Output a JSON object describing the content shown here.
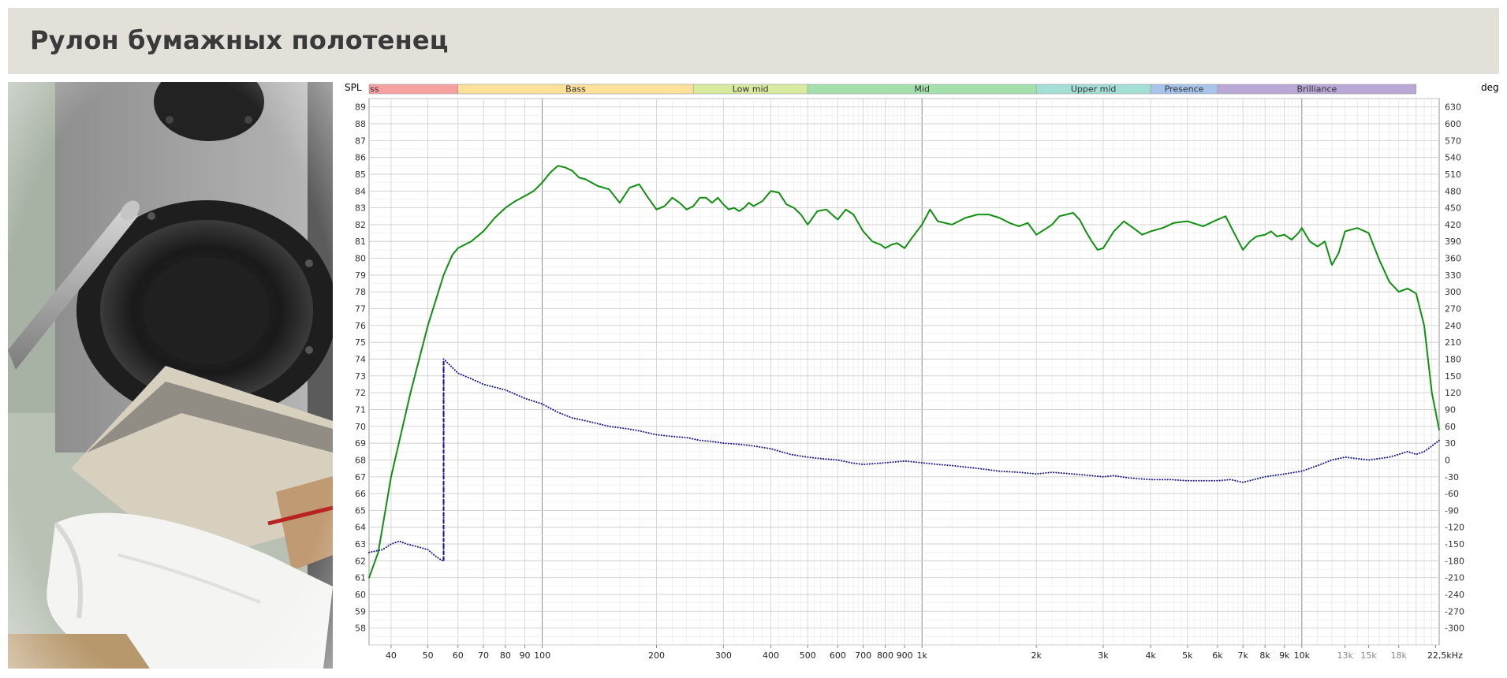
{
  "header": {
    "title": "Рулон бумажных полотенец"
  },
  "photo": {
    "subject": "speaker-woofer-with-measurement-microphone-and-paper-towel-roll"
  },
  "chart_data": {
    "type": "line",
    "title": "",
    "xscale": "log",
    "xlim": [
      35,
      23000
    ],
    "x_ticks": [
      {
        "v": 40,
        "label": "40"
      },
      {
        "v": 50,
        "label": "50"
      },
      {
        "v": 60,
        "label": "60"
      },
      {
        "v": 70,
        "label": "70"
      },
      {
        "v": 80,
        "label": "80"
      },
      {
        "v": 90,
        "label": "90"
      },
      {
        "v": 100,
        "label": "100"
      },
      {
        "v": 200,
        "label": "200"
      },
      {
        "v": 300,
        "label": "300"
      },
      {
        "v": 400,
        "label": "400"
      },
      {
        "v": 500,
        "label": "500"
      },
      {
        "v": 600,
        "label": "600"
      },
      {
        "v": 700,
        "label": "700"
      },
      {
        "v": 800,
        "label": "800"
      },
      {
        "v": 900,
        "label": "900"
      },
      {
        "v": 1000,
        "label": "1k"
      },
      {
        "v": 2000,
        "label": "2k"
      },
      {
        "v": 3000,
        "label": "3k"
      },
      {
        "v": 4000,
        "label": "4k"
      },
      {
        "v": 5000,
        "label": "5k"
      },
      {
        "v": 6000,
        "label": "6k"
      },
      {
        "v": 7000,
        "label": "7k"
      },
      {
        "v": 8000,
        "label": "8k"
      },
      {
        "v": 9000,
        "label": "9k"
      },
      {
        "v": 10000,
        "label": "10k"
      },
      {
        "v": 13000,
        "label": "13k"
      },
      {
        "v": 15000,
        "label": "15k"
      },
      {
        "v": 18000,
        "label": "18k"
      },
      {
        "v": 22500,
        "label": "22,5kHz"
      }
    ],
    "y_left": {
      "label": "SPL",
      "lim": [
        57,
        89.5
      ],
      "ticks": [
        58,
        59,
        60,
        61,
        62,
        63,
        64,
        65,
        66,
        67,
        68,
        69,
        70,
        71,
        72,
        73,
        74,
        75,
        76,
        77,
        78,
        79,
        80,
        81,
        82,
        83,
        84,
        85,
        86,
        87,
        88,
        89
      ]
    },
    "y_right": {
      "label": "deg",
      "lim": [
        -330,
        645
      ],
      "ticks": [
        -300,
        -270,
        -240,
        -210,
        -180,
        -150,
        -120,
        -90,
        -60,
        -30,
        0,
        30,
        60,
        90,
        120,
        150,
        180,
        210,
        240,
        270,
        300,
        330,
        360,
        390,
        420,
        450,
        480,
        510,
        540,
        570,
        600,
        630
      ]
    },
    "grid": true,
    "bands": [
      {
        "label": "ss",
        "from": 35,
        "to": 60,
        "color": "#f7a0a0"
      },
      {
        "label": "Bass",
        "from": 60,
        "to": 250,
        "color": "#fde09a"
      },
      {
        "label": "Low mid",
        "from": 250,
        "to": 500,
        "color": "#d7eaa0"
      },
      {
        "label": "Mid",
        "from": 500,
        "to": 2000,
        "color": "#a3e0ad"
      },
      {
        "label": "Upper mid",
        "from": 2000,
        "to": 4000,
        "color": "#a4dfd6"
      },
      {
        "label": "Presence",
        "from": 4000,
        "to": 6000,
        "color": "#a8c4ea"
      },
      {
        "label": "Brilliance",
        "from": 6000,
        "to": 20000,
        "color": "#b9a8d6"
      }
    ],
    "series": [
      {
        "axis": "left",
        "color": "#109010",
        "style": "solid",
        "x": [
          35,
          37,
          40,
          45,
          50,
          55,
          58,
          60,
          65,
          70,
          75,
          80,
          85,
          90,
          95,
          100,
          105,
          110,
          115,
          120,
          125,
          130,
          140,
          150,
          160,
          170,
          180,
          190,
          200,
          210,
          220,
          230,
          240,
          250,
          260,
          270,
          280,
          290,
          300,
          310,
          320,
          330,
          340,
          350,
          360,
          380,
          400,
          420,
          440,
          460,
          480,
          500,
          530,
          560,
          600,
          630,
          660,
          700,
          740,
          780,
          800,
          830,
          860,
          900,
          940,
          1000,
          1050,
          1100,
          1200,
          1300,
          1400,
          1500,
          1600,
          1700,
          1800,
          1900,
          2000,
          2100,
          2200,
          2300,
          2400,
          2500,
          2600,
          2700,
          2800,
          2900,
          3000,
          3200,
          3400,
          3600,
          3800,
          4000,
          4300,
          4600,
          5000,
          5500,
          6000,
          6300,
          6600,
          7000,
          7300,
          7600,
          8000,
          8300,
          8600,
          9000,
          9400,
          9800,
          10000,
          10500,
          11000,
          11500,
          12000,
          12500,
          13000,
          14000,
          15000,
          16000,
          17000,
          18000,
          19000,
          20000,
          21000,
          22000,
          23000
        ],
        "values": [
          61.0,
          62.5,
          67.0,
          72.0,
          76.0,
          79.0,
          80.2,
          80.6,
          81.0,
          81.6,
          82.4,
          83.0,
          83.4,
          83.7,
          84.0,
          84.5,
          85.1,
          85.5,
          85.4,
          85.2,
          84.8,
          84.7,
          84.3,
          84.1,
          83.3,
          84.2,
          84.4,
          83.6,
          82.9,
          83.1,
          83.6,
          83.3,
          82.9,
          83.1,
          83.6,
          83.6,
          83.3,
          83.6,
          83.2,
          82.9,
          83.0,
          82.8,
          83.0,
          83.3,
          83.1,
          83.4,
          84.0,
          83.9,
          83.2,
          83.0,
          82.6,
          82.0,
          82.8,
          82.9,
          82.3,
          82.9,
          82.6,
          81.6,
          81.0,
          80.8,
          80.6,
          80.8,
          80.9,
          80.6,
          81.2,
          82.0,
          82.9,
          82.2,
          82.0,
          82.4,
          82.6,
          82.6,
          82.4,
          82.1,
          81.9,
          82.1,
          81.4,
          81.7,
          82.0,
          82.5,
          82.6,
          82.7,
          82.3,
          81.6,
          81.0,
          80.5,
          80.6,
          81.6,
          82.2,
          81.8,
          81.4,
          81.6,
          81.8,
          82.1,
          82.2,
          81.9,
          82.3,
          82.5,
          81.6,
          80.5,
          81.0,
          81.3,
          81.4,
          81.6,
          81.3,
          81.4,
          81.1,
          81.5,
          81.8,
          81.0,
          80.7,
          81.0,
          79.6,
          80.3,
          81.6,
          81.8,
          81.5,
          79.9,
          78.6,
          78.0,
          78.2,
          77.9,
          76.0,
          72.0,
          69.8
        ]
      },
      {
        "axis": "right",
        "color": "#1010a0",
        "style": "dotted",
        "x": [
          35,
          38,
          40,
          42,
          44,
          47,
          50,
          52,
          54,
          55,
          55.01,
          56,
          58,
          60,
          65,
          70,
          80,
          90,
          100,
          110,
          120,
          130,
          150,
          170,
          180,
          200,
          220,
          240,
          260,
          280,
          300,
          330,
          360,
          400,
          450,
          500,
          550,
          600,
          650,
          700,
          800,
          900,
          1000,
          1100,
          1200,
          1400,
          1600,
          1800,
          2000,
          2200,
          2500,
          2800,
          3000,
          3200,
          3500,
          4000,
          4500,
          5000,
          5500,
          6000,
          6500,
          7000,
          8000,
          9000,
          10000,
          10500,
          11000,
          11500,
          12000,
          13000,
          15000,
          17000,
          18000,
          19000,
          20000,
          21000,
          22000,
          23000
        ],
        "values": [
          -165,
          -160,
          -150,
          -145,
          -150,
          -155,
          -160,
          -170,
          -178,
          -180,
          180,
          175,
          165,
          155,
          145,
          135,
          125,
          110,
          100,
          85,
          75,
          70,
          60,
          55,
          52,
          45,
          42,
          40,
          35,
          33,
          30,
          28,
          25,
          20,
          10,
          5,
          2,
          0,
          -5,
          -8,
          -5,
          -2,
          -5,
          -8,
          -10,
          -15,
          -20,
          -22,
          -25,
          -22,
          -25,
          -28,
          -30,
          -28,
          -32,
          -35,
          -35,
          -37,
          -37,
          -37,
          -35,
          -40,
          -30,
          -25,
          -20,
          -15,
          -10,
          -5,
          0,
          5,
          0,
          5,
          10,
          15,
          10,
          15,
          25,
          35
        ]
      },
      {
        "axis": "right",
        "color": "#1010a0",
        "style": "dashed",
        "x": [
          55,
          55
        ],
        "values": [
          -180,
          180
        ]
      }
    ]
  }
}
